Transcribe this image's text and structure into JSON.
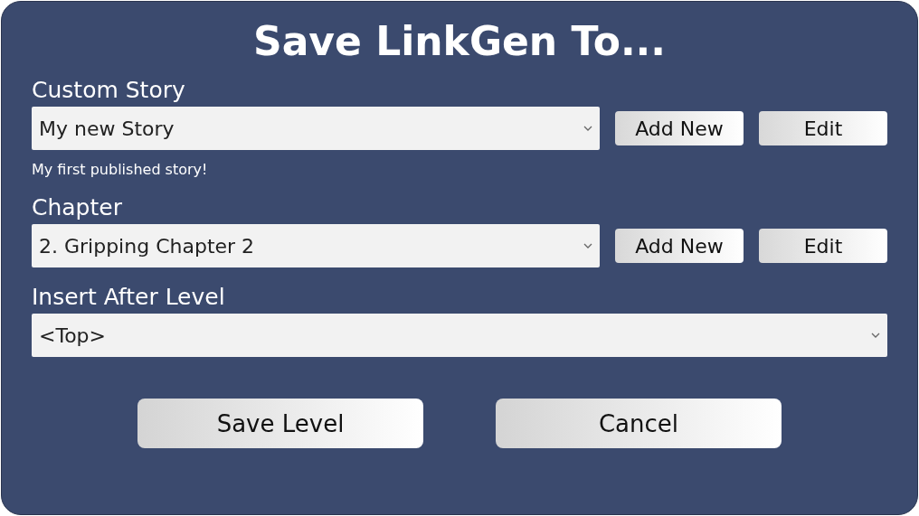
{
  "title": "Save LinkGen To...",
  "sections": [
    {
      "label": "Custom Story",
      "value": "My new Story",
      "buttons": [
        "Add New",
        "Edit"
      ],
      "hint": "My first published story!"
    },
    {
      "label": "Chapter",
      "value": "2. Gripping Chapter 2",
      "buttons": [
        "Add New",
        "Edit"
      ]
    },
    {
      "label": "Insert After Level",
      "value": "<Top>"
    }
  ],
  "actions": [
    "Save Level",
    "Cancel"
  ]
}
